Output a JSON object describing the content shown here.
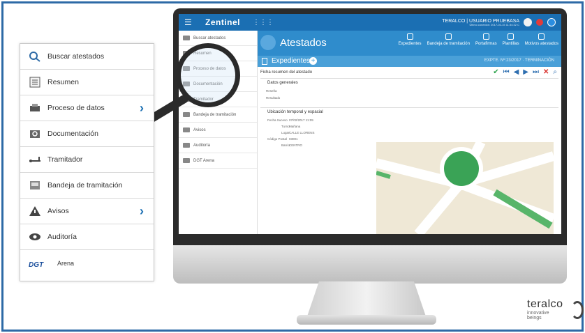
{
  "app": {
    "brand": "Zentinel",
    "topbar": {
      "user": "TERALCO | USUARIO PRUEBASA",
      "last_connection": "Último conexión: 2017-02-15 11:34:32 C"
    },
    "header": {
      "title": "Atestados",
      "nav": [
        "Expedientes",
        "Bandeja de tramitación",
        "Portafirmas",
        "Plantillas",
        "Motivos atestados"
      ]
    },
    "subheader": {
      "title": "Expedientes",
      "expte": "EXPTE. Nº:23/2017 · TERMINACIÓN"
    },
    "content": {
      "ficha_title": "Ficha resumen del atestado",
      "sections": {
        "generales": "Datos generales",
        "ubicacion": "Ubicación temporal y espacial"
      },
      "fields": {
        "resena": "Reseña",
        "resultado": "Resultado",
        "fecha_label": "Fecha Suceso",
        "fecha_value": "07/02/2017 11:09",
        "turno_label": "Turno",
        "turno_value": "Mañana",
        "lugar_label": "Lugar",
        "lugar_value": "CALLE LLORENS",
        "cp_label": "Código Postal",
        "cp_value": "03001",
        "barrio_label": "Barrio",
        "barrio_value": "CENTRO"
      }
    },
    "sidebar_small": [
      "Buscar atestados",
      "Resumen",
      "Proceso de datos",
      "Documentación",
      "Tramitador",
      "Bandeja de tramitación",
      "Avisos",
      "Auditoría",
      "DGT Arena"
    ]
  },
  "zoom_menu": [
    {
      "label": "Buscar atestados",
      "icon": "search-icon",
      "chevron": false
    },
    {
      "label": "Resumen",
      "icon": "document-icon",
      "chevron": false
    },
    {
      "label": "Proceso de datos",
      "icon": "printer-icon",
      "chevron": true
    },
    {
      "label": "Documentación",
      "icon": "folder-search-icon",
      "chevron": false
    },
    {
      "label": "Tramitador",
      "icon": "route-icon",
      "chevron": false
    },
    {
      "label": "Bandeja de tramitación",
      "icon": "tray-icon",
      "chevron": false
    },
    {
      "label": "Avisos",
      "icon": "warning-icon",
      "chevron": true
    },
    {
      "label": "Auditoría",
      "icon": "eye-icon",
      "chevron": false
    },
    {
      "label": "Arena",
      "icon": "dgt-logo-icon",
      "chevron": false,
      "prefix": "DGT"
    }
  ],
  "logo": {
    "name": "teralco",
    "tag1": "innovative",
    "tag2": "beings"
  }
}
